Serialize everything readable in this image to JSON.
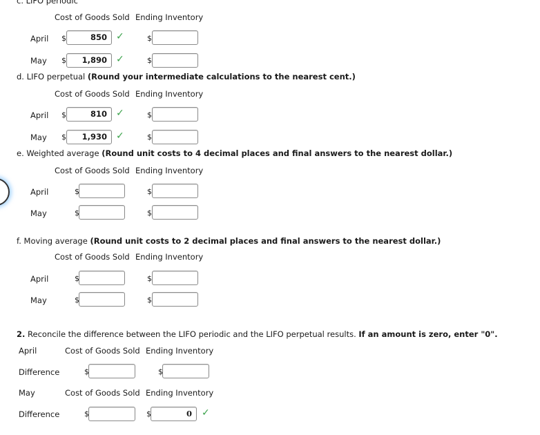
{
  "sections": {
    "c": {
      "title": "c. LIFO periodic",
      "col_cogs": "Cost of Goods Sold",
      "col_ei": "Ending Inventory",
      "rows": [
        {
          "label": "April",
          "cogs": "850",
          "ei": ""
        },
        {
          "label": "May",
          "cogs": "1,890",
          "ei": ""
        }
      ]
    },
    "d": {
      "title_plain": "d. LIFO perpetual ",
      "title_bold": "(Round your intermediate calculations to the nearest cent.)",
      "col_cogs": "Cost of Goods Sold",
      "col_ei": "Ending Inventory",
      "rows": [
        {
          "label": "April",
          "cogs": "810",
          "ei": ""
        },
        {
          "label": "May",
          "cogs": "1,930",
          "ei": ""
        }
      ]
    },
    "e": {
      "title_plain": "e. Weighted average ",
      "title_bold": "(Round unit costs to 4 decimal places and final answers to the nearest dollar.)",
      "col_cogs": "Cost of Goods Sold",
      "col_ei": "Ending Inventory",
      "rows": [
        {
          "label": "April",
          "cogs": "",
          "ei": ""
        },
        {
          "label": "May",
          "cogs": "",
          "ei": ""
        }
      ]
    },
    "f": {
      "title_plain": "f. Moving average ",
      "title_bold": "(Round unit costs to 2 decimal places and final answers to the nearest dollar.)",
      "col_cogs": "Cost of Goods Sold",
      "col_ei": "Ending Inventory",
      "rows": [
        {
          "label": "April",
          "cogs": "",
          "ei": ""
        },
        {
          "label": "May",
          "cogs": "",
          "ei": ""
        }
      ]
    },
    "q2": {
      "num": "2.",
      "title_plain": " Reconcile the difference between the LIFO periodic and the LIFO perpetual results. ",
      "title_bold": "If an amount is zero, enter \"0\".",
      "april": {
        "month": "April",
        "col_cogs": "Cost of Goods Sold",
        "col_ei": "Ending Inventory",
        "row_label": "Difference",
        "cogs": "",
        "ei": ""
      },
      "may": {
        "month": "May",
        "col_cogs": "Cost of Goods Sold",
        "col_ei": "Ending Inventory",
        "row_label": "Difference",
        "cogs": "",
        "ei": "0"
      }
    }
  },
  "currency_symbol": "$",
  "check_glyph": "✓",
  "colors": {
    "correct": "#3aa24a"
  }
}
